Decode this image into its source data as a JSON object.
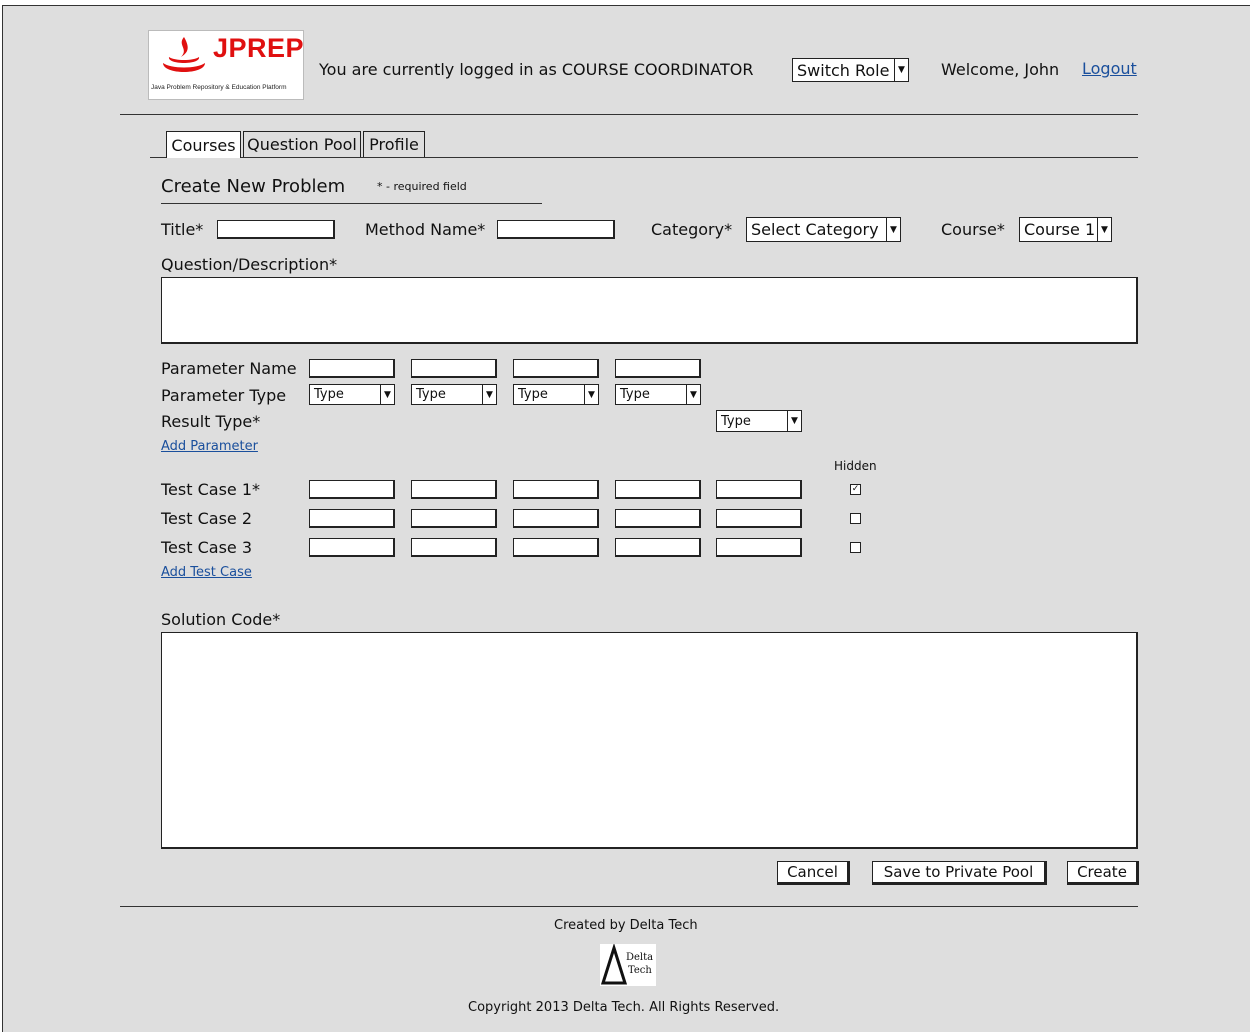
{
  "header": {
    "logo_name": "JPREP",
    "logo_tagline": "Java Problem Repository & Education Platform",
    "logged_in_text": "You are currently logged in as COURSE COORDINATOR",
    "switch_role": "Switch Role",
    "welcome": "Welcome, John",
    "logout": "Logout"
  },
  "tabs": [
    {
      "label": "Courses",
      "active": true
    },
    {
      "label": "Question Pool",
      "active": false
    },
    {
      "label": "Profile",
      "active": false
    }
  ],
  "form": {
    "heading": "Create New Problem",
    "required_note": "* - required field",
    "title_label": "Title*",
    "title_value": "",
    "method_label": "Method Name*",
    "method_value": "",
    "category_label": "Category*",
    "category_value": "Select Category",
    "course_label": "Course*",
    "course_value": "Course 1",
    "description_label": "Question/Description*",
    "description_value": "",
    "param_name_label": "Parameter Name",
    "param_type_label": "Parameter Type",
    "param_types": [
      "Type",
      "Type",
      "Type",
      "Type"
    ],
    "result_type_label": "Result Type*",
    "result_type_value": "Type",
    "add_parameter": "Add Parameter",
    "hidden_label": "Hidden",
    "test_cases": [
      {
        "label": "Test Case 1*",
        "hidden": true
      },
      {
        "label": "Test Case 2",
        "hidden": false
      },
      {
        "label": "Test Case 3",
        "hidden": false
      }
    ],
    "add_test_case": "Add Test Case",
    "solution_label": "Solution Code*",
    "solution_value": ""
  },
  "actions": {
    "cancel": "Cancel",
    "save_private": "Save to Private Pool",
    "create": "Create"
  },
  "footer": {
    "created_by": "Created by Delta Tech",
    "delta_logo_text_1": "Delta",
    "delta_logo_text_2": "Tech",
    "copyright": "Copyright 2013 Delta Tech. All Rights Reserved."
  }
}
